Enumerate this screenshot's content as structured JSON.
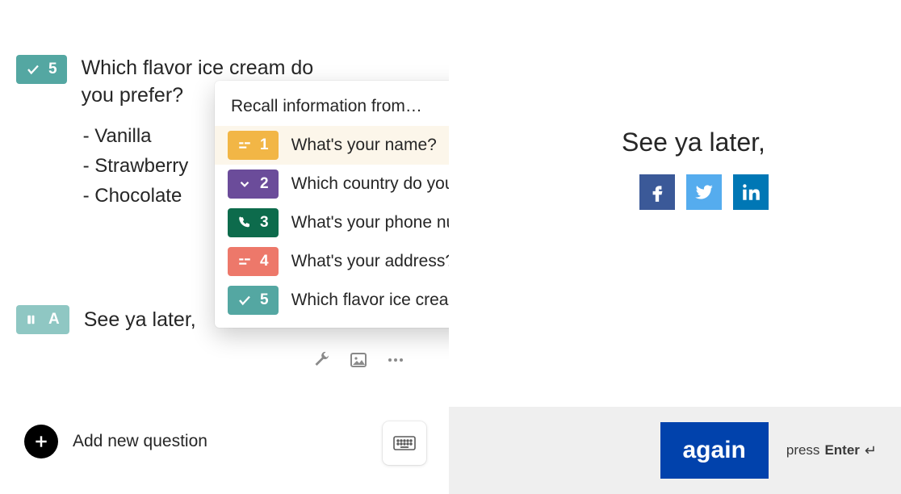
{
  "left": {
    "q5": {
      "number": "5",
      "text": "Which flavor ice cream do you prefer?",
      "choices": [
        "Vanilla",
        "Strawberry",
        "Chocolate"
      ]
    },
    "end": {
      "badge": "A",
      "text": "See ya later,"
    },
    "add_question_label": "Add new question"
  },
  "popover": {
    "title": "Recall information from…",
    "items": [
      {
        "num": "1",
        "label": "What's your name?",
        "color": "amber",
        "icon": "text"
      },
      {
        "num": "2",
        "label": "Which country do you li…",
        "color": "purple",
        "icon": "dropdown"
      },
      {
        "num": "3",
        "label": "What's your phone nu…",
        "color": "green",
        "icon": "phone"
      },
      {
        "num": "4",
        "label": "What's your address?",
        "color": "coral",
        "icon": "text"
      },
      {
        "num": "5",
        "label": "Which flavor ice cream …",
        "color": "teal",
        "icon": "check"
      }
    ]
  },
  "right": {
    "preview_text": "See ya later,",
    "again_label": "again",
    "press_label": "press",
    "enter_label": "Enter",
    "enter_glyph": "↵"
  }
}
